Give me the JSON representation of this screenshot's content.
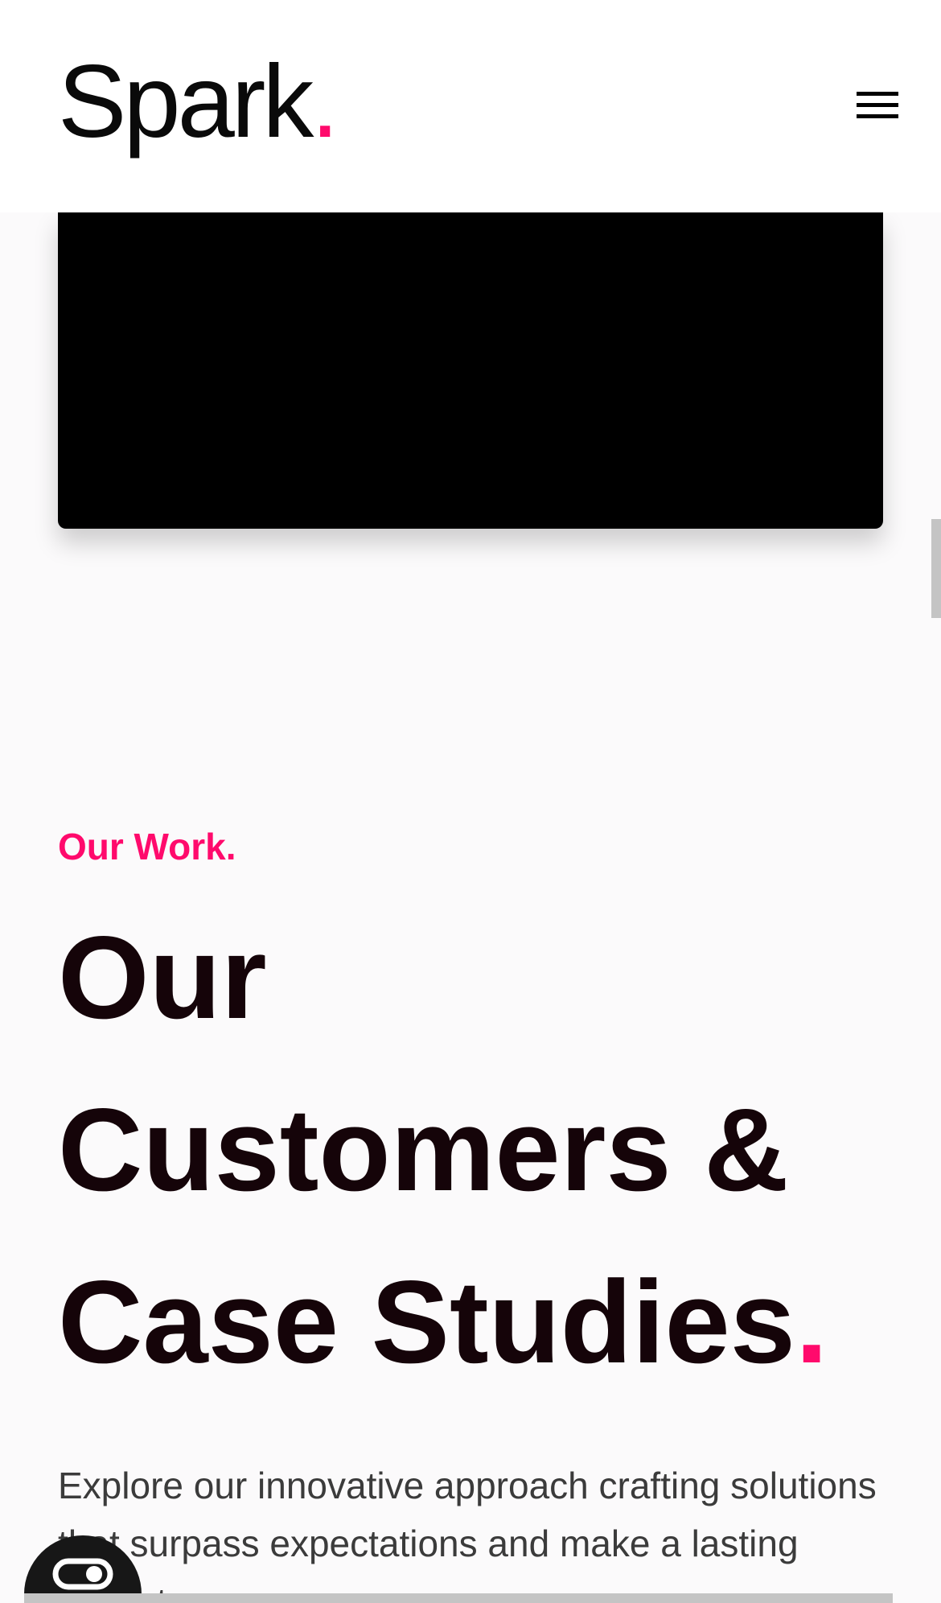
{
  "header": {
    "logo_text": "Spark",
    "logo_dot": "."
  },
  "colors": {
    "accent": "#ff0a6c",
    "text_dark": "#150409",
    "body_text": "#3b3b3b"
  },
  "icons": {
    "menu": "hamburger-menu-icon",
    "chat": "chat-icon"
  },
  "section": {
    "eyebrow": "Our Work.",
    "headline_lines": [
      "Our",
      "Customers &",
      "Case Studies"
    ],
    "headline_dot": ".",
    "description": "Explore our innovative approach crafting solutions that surpass expectations and make a lasting impact."
  }
}
